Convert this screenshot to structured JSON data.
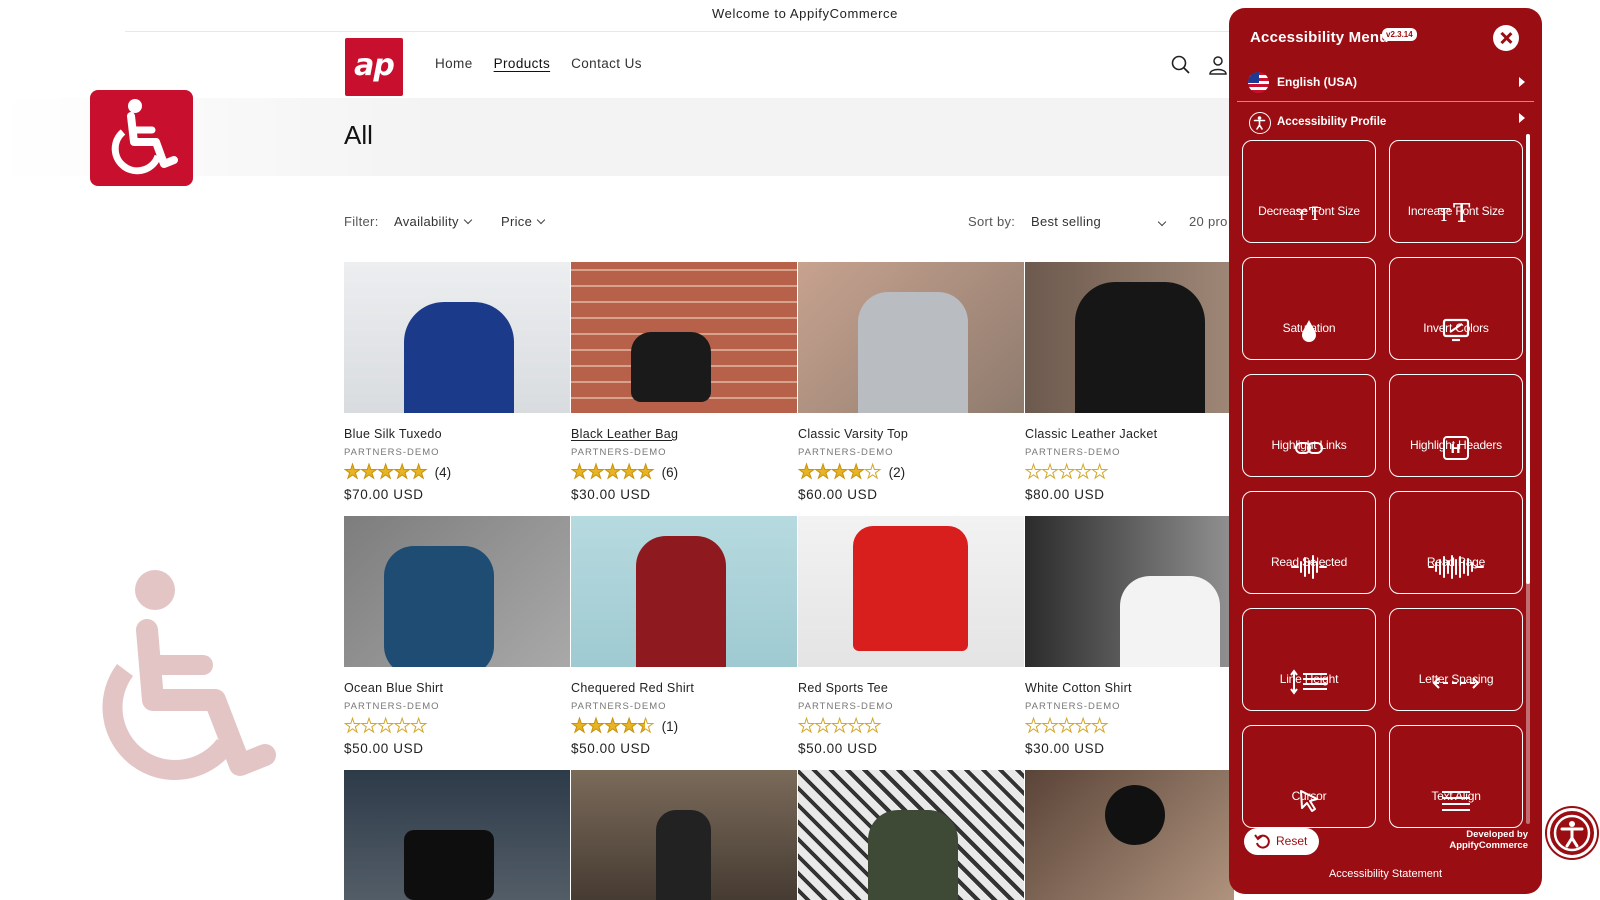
{
  "announcement": "Welcome to AppifyCommerce",
  "header": {
    "logo_text": "ap",
    "nav": [
      "Home",
      "Products",
      "Contact Us"
    ],
    "active_nav": "Products"
  },
  "collection": {
    "title": "All"
  },
  "toolbar": {
    "filter_label": "Filter:",
    "availability": "Availability",
    "price": "Price",
    "sort_label": "Sort by:",
    "sort_value": "Best selling",
    "product_count": "20 pro"
  },
  "products": [
    {
      "name": "Blue Silk Tuxedo",
      "vendor": "PARTNERS-DEMO",
      "rating": 5,
      "count": "(4)",
      "price": "$70.00 USD"
    },
    {
      "name": "Black Leather Bag",
      "vendor": "PARTNERS-DEMO",
      "rating": 5,
      "count": "(6)",
      "price": "$30.00 USD"
    },
    {
      "name": "Classic Varsity Top",
      "vendor": "PARTNERS-DEMO",
      "rating": 4,
      "count": "(2)",
      "price": "$60.00 USD"
    },
    {
      "name": "Classic Leather Jacket",
      "vendor": "PARTNERS-DEMO",
      "rating": 0,
      "count": "",
      "price": "$80.00 USD"
    },
    {
      "name": "Ocean Blue Shirt",
      "vendor": "PARTNERS-DEMO",
      "rating": 0,
      "count": "",
      "price": "$50.00 USD"
    },
    {
      "name": "Chequered Red Shirt",
      "vendor": "PARTNERS-DEMO",
      "rating": 4.5,
      "count": "(1)",
      "price": "$50.00 USD"
    },
    {
      "name": "Red Sports Tee",
      "vendor": "PARTNERS-DEMO",
      "rating": 0,
      "count": "",
      "price": "$50.00 USD"
    },
    {
      "name": "White Cotton Shirt",
      "vendor": "PARTNERS-DEMO",
      "rating": 0,
      "count": "",
      "price": "$30.00 USD"
    },
    {
      "name": "",
      "vendor": "",
      "rating": null,
      "count": "",
      "price": ""
    },
    {
      "name": "",
      "vendor": "",
      "rating": null,
      "count": "",
      "price": ""
    },
    {
      "name": "",
      "vendor": "",
      "rating": null,
      "count": "",
      "price": ""
    },
    {
      "name": "",
      "vendor": "",
      "rating": null,
      "count": "",
      "price": ""
    }
  ],
  "accessibility": {
    "title": "Accessibility Menu",
    "version": "v2.3.14",
    "language": "English (USA)",
    "profile": "Accessibility Profile",
    "tiles": [
      {
        "label": "Decrease Font Size",
        "icon": "decrease-font-icon"
      },
      {
        "label": "Increase Font Size",
        "icon": "increase-font-icon"
      },
      {
        "label": "Saturation",
        "icon": "droplet-icon"
      },
      {
        "label": "Invert Colors",
        "icon": "monitor-icon"
      },
      {
        "label": "Highlight Links",
        "icon": "link-icon"
      },
      {
        "label": "Highlight Headers",
        "icon": "heading-icon"
      },
      {
        "label": "Read Selected",
        "icon": "soundwave-icon"
      },
      {
        "label": "Read Page",
        "icon": "soundwave-wide-icon"
      },
      {
        "label": "Line Height",
        "icon": "line-height-icon"
      },
      {
        "label": "Letter Spacing",
        "icon": "letter-spacing-icon"
      },
      {
        "label": "Cursor",
        "icon": "cursor-icon"
      },
      {
        "label": "Text Align",
        "icon": "text-align-icon"
      }
    ],
    "reset": "Reset",
    "developed_by": "Developed by",
    "developer": "AppifyCommerce",
    "statement": "Accessibility Statement"
  },
  "colors": {
    "panel": "#9a0d12",
    "brand": "#c8102e",
    "star": "#e8b425"
  }
}
